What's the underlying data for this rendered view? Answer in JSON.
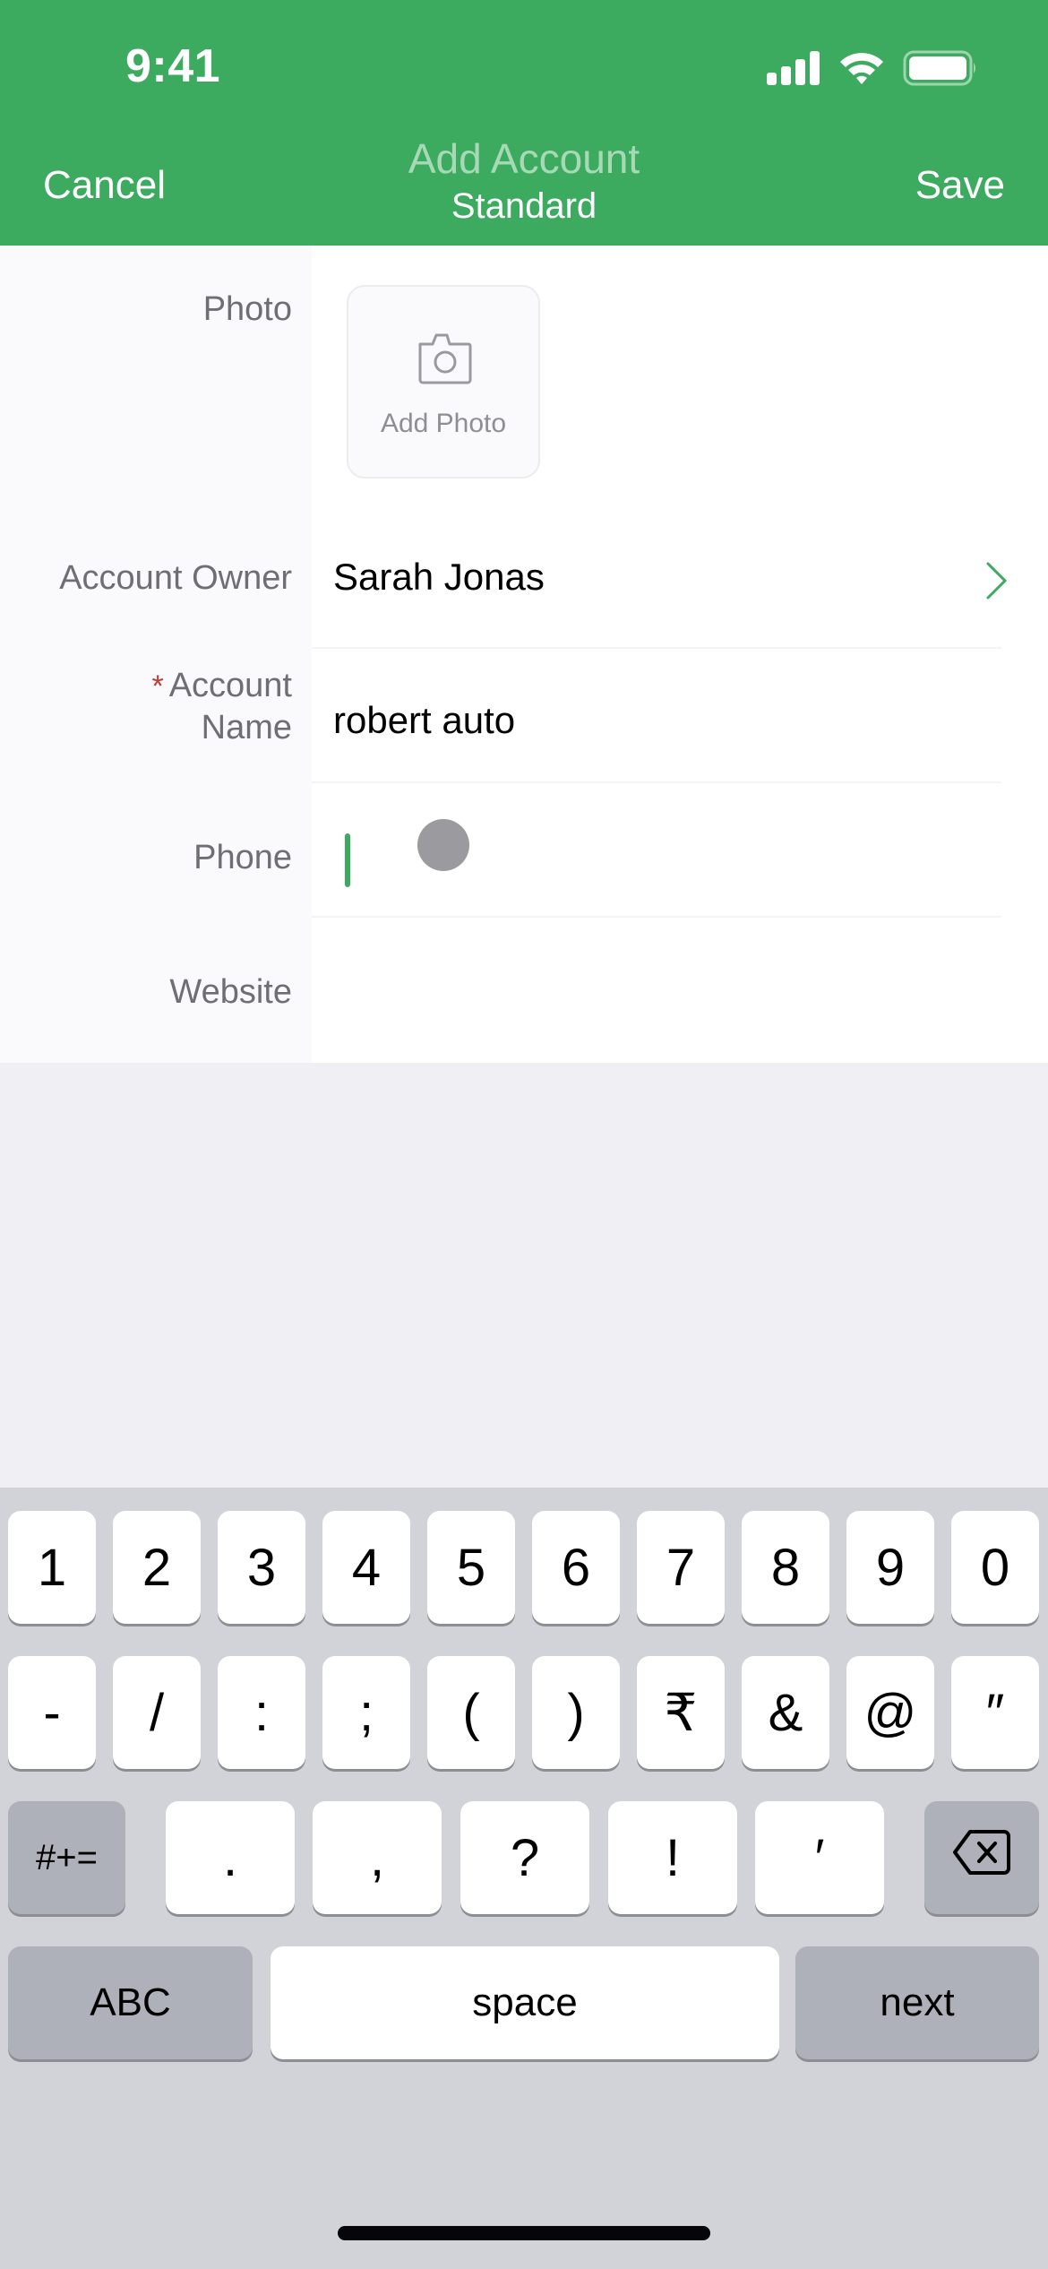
{
  "status_bar": {
    "time": "9:41",
    "icons": [
      "cellular-signal-icon",
      "wifi-icon",
      "battery-icon"
    ]
  },
  "nav": {
    "cancel_label": "Cancel",
    "title": "Add Account",
    "subtitle": "Standard",
    "save_label": "Save"
  },
  "colors": {
    "brand_green": "#3dab5f",
    "required_red": "#c23934",
    "label_gray": "#6e6e73",
    "keyboard_bg": "#d2d3d8"
  },
  "form": {
    "photo": {
      "label": "Photo",
      "button_label": "Add Photo",
      "icon": "camera-icon"
    },
    "account_owner": {
      "label": "Account Owner",
      "value": "Sarah Jonas",
      "icon": "chevron-right-icon"
    },
    "account_name": {
      "required_marker": "*",
      "label_line1": "Account",
      "label_line2": "Name",
      "value": "robert auto"
    },
    "phone": {
      "label": "Phone",
      "value": ""
    },
    "website": {
      "label": "Website",
      "value": ""
    }
  },
  "keyboard": {
    "row1": [
      "1",
      "2",
      "3",
      "4",
      "5",
      "6",
      "7",
      "8",
      "9",
      "0"
    ],
    "row2": [
      "-",
      "/",
      ":",
      ";",
      "(",
      ")",
      "₹",
      "&",
      "@",
      "″"
    ],
    "row3": {
      "toggle_label": "#+=",
      "keys": [
        ".",
        ",",
        "?",
        "!",
        "′"
      ],
      "delete_icon": "backspace-icon"
    },
    "row4": {
      "abc_label": "ABC",
      "space_label": "space",
      "next_label": "next"
    }
  }
}
